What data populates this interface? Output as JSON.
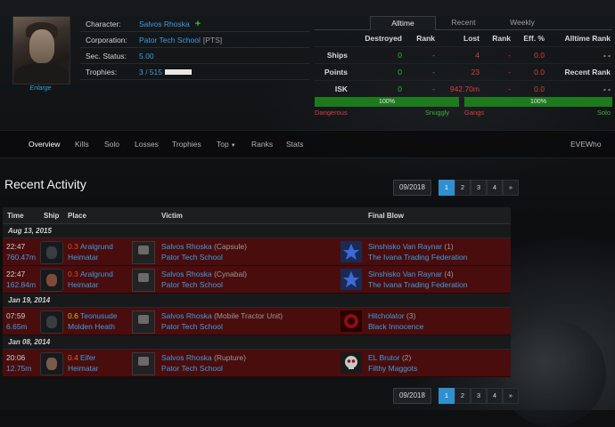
{
  "character": {
    "labels": {
      "character": "Character:",
      "corporation": "Corporation:",
      "sec_status": "Sec. Status:",
      "trophies": "Trophies:"
    },
    "name": "Salvos Rhoska",
    "add_icon": "plus-icon",
    "corporation": "Pator Tech School",
    "corp_ticker": "[PTS]",
    "sec_status": "5.00",
    "trophies": "3 / 515",
    "trophy_progress": 0.006,
    "enlarge": "Enlarge"
  },
  "stats": {
    "tabs": [
      "Alltime",
      "Recent",
      "Weekly"
    ],
    "active_tab": "Alltime",
    "headers": [
      "Destroyed",
      "Rank",
      "Lost",
      "Rank",
      "Eff. %",
      "Alltime Rank"
    ],
    "rows": [
      {
        "label": "Ships",
        "destroyed": "0",
        "rank1": "-",
        "lost": "4",
        "rank2": "-",
        "eff": "0.0",
        "alltime": "- -"
      },
      {
        "label": "Points",
        "destroyed": "0",
        "rank1": "-",
        "lost": "23",
        "rank2": "-",
        "eff": "0.0",
        "alltime": "Recent Rank"
      },
      {
        "label": "ISK",
        "destroyed": "0",
        "rank1": "-",
        "lost": "942.70m",
        "rank2": "-",
        "eff": "0.0",
        "alltime": "- -"
      }
    ],
    "bar_left": {
      "text": "100%",
      "left_label": "Dangerous",
      "right_label": "Snuggly",
      "value": 1.0
    },
    "bar_right": {
      "text": "100%",
      "left_label": "Gangs",
      "right_label": "Solo",
      "value": 1.0
    }
  },
  "nav": {
    "items": [
      "Overview",
      "Kills",
      "Solo",
      "Losses",
      "Trophies",
      "Top",
      "Ranks",
      "Stats"
    ],
    "active": "Overview",
    "right": "EVEWho"
  },
  "activity": {
    "title": "Recent Activity",
    "month": "09/2018",
    "pages": [
      "1",
      "2",
      "3",
      "4",
      "»"
    ],
    "active_page": "1",
    "columns": [
      "Time",
      "Ship",
      "Place",
      "Victim",
      "Final Blow"
    ],
    "groups": [
      {
        "date": "Aug 13, 2015",
        "rows": [
          {
            "time": "22:47",
            "isk": "760.47m",
            "sec": "0.3",
            "system": "Aralgrund",
            "region": "Heimatar",
            "victim": "Salvos Rhoska",
            "ship": "(Capsule)",
            "victim_corp": "Pator Tech School",
            "fb_name": "Sinshisko Van Raynar",
            "fb_count": "(1)",
            "fb_corp": "The Ivana Trading Federation",
            "sec_color": "red"
          },
          {
            "time": "22:47",
            "isk": "162.84m",
            "sec": "0.3",
            "system": "Aralgrund",
            "region": "Heimatar",
            "victim": "Salvos Rhoska",
            "ship": "(Cynabal)",
            "victim_corp": "Pator Tech School",
            "fb_name": "Sinshisko Van Raynar",
            "fb_count": "(4)",
            "fb_corp": "The Ivana Trading Federation",
            "sec_color": "red"
          }
        ]
      },
      {
        "date": "Jan 19, 2014",
        "rows": [
          {
            "time": "07:59",
            "isk": "6.65m",
            "sec": "0.6",
            "system": "Teonusude",
            "region": "Molden Heath",
            "victim": "Salvos Rhoska",
            "ship": "(Mobile Tractor Unit)",
            "victim_corp": "Pator Tech School",
            "fb_name": "Hitcholator",
            "fb_count": "(3)",
            "fb_corp": "Black Innocence",
            "sec_color": "yellow"
          }
        ]
      },
      {
        "date": "Jan 08, 2014",
        "rows": [
          {
            "time": "20:06",
            "isk": "12.75m",
            "sec": "0.4",
            "system": "Eifer",
            "region": "Heimatar",
            "victim": "Salvos Rhoska",
            "ship": "(Rupture)",
            "victim_corp": "Pator Tech School",
            "fb_name": "EL Brutor",
            "fb_count": "(2)",
            "fb_corp": "Filthy Maggots",
            "sec_color": "orange"
          }
        ]
      }
    ]
  }
}
